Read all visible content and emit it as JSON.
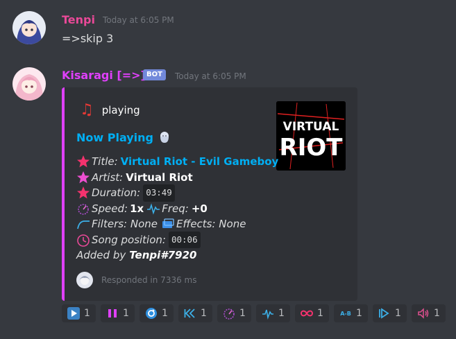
{
  "message1": {
    "username": "Tenpi",
    "username_color": "#ea4998",
    "timestamp": "Today at 6:05 PM",
    "content": "=>skip 3"
  },
  "message2": {
    "username": "Kisaragi [=>]",
    "username_color": "#e040fb",
    "bot_tag": "BOT",
    "timestamp": "Today at 6:05 PM"
  },
  "embed": {
    "accent_color": "#e040fb",
    "author": "playing",
    "title": "Now Playing",
    "thumbnail_text_top": "VIRTUAL",
    "thumbnail_text_bottom": "RIOT",
    "lines": {
      "title_label": "Title:",
      "title_value": "Virtual Riot - Evil Gameboy",
      "artist_label": "Artist:",
      "artist_value": "Virtual Riot",
      "duration_label": "Duration:",
      "duration_value": "03:49",
      "speed_label": "Speed:",
      "speed_value": "1x",
      "freq_label": "Freq:",
      "freq_value": "+0",
      "filters_label": "Filters: None",
      "effects_label": "Effects: None",
      "position_label": "Song position:",
      "position_value": "00:06",
      "added_label": "Added by",
      "added_value": "Tenpi#7920"
    },
    "footer": "Responded in 7336 ms"
  },
  "reactions": [
    {
      "icon": "play-icon",
      "count": "1"
    },
    {
      "icon": "pause-icon",
      "count": "1"
    },
    {
      "icon": "loop-icon",
      "count": "1"
    },
    {
      "icon": "rewind-icon",
      "count": "1"
    },
    {
      "icon": "speed-icon",
      "count": "1"
    },
    {
      "icon": "frequency-icon",
      "count": "1"
    },
    {
      "icon": "infinity-icon",
      "count": "1"
    },
    {
      "icon": "ab-loop-icon",
      "count": "1"
    },
    {
      "icon": "skip-icon",
      "count": "1"
    },
    {
      "icon": "volume-icon",
      "count": "1"
    }
  ]
}
